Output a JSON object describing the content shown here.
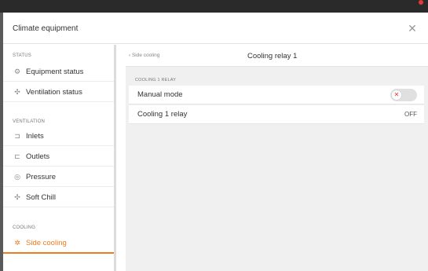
{
  "app": {
    "window_title": ""
  },
  "dialog": {
    "title": "Climate equipment",
    "close_icon": "close-icon"
  },
  "sidebar": {
    "sections": [
      {
        "label": "STATUS"
      },
      {
        "label": "VENTILATION"
      },
      {
        "label": "COOLING"
      }
    ],
    "items": [
      {
        "label": "Equipment status",
        "icon": "equipment-icon",
        "glyph": "⚙"
      },
      {
        "label": "Ventilation status",
        "icon": "fan-icon",
        "glyph": "✣"
      },
      {
        "label": "Inlets",
        "icon": "inlet-icon",
        "glyph": "⊐"
      },
      {
        "label": "Outlets",
        "icon": "outlet-icon",
        "glyph": "⊏"
      },
      {
        "label": "Pressure",
        "icon": "pressure-icon",
        "glyph": "◎"
      },
      {
        "label": "Soft Chill",
        "icon": "fan-icon",
        "glyph": "✣"
      },
      {
        "label": "Side cooling",
        "icon": "cooling-icon",
        "glyph": "✲",
        "active": true
      }
    ]
  },
  "main": {
    "back_label": "‹  Side cooling",
    "title": "Cooling relay 1",
    "group_label": "COOLING 1 RELAY",
    "rows": [
      {
        "label": "Manual mode",
        "control": "toggle",
        "toggle_on": false,
        "knob_glyph": "✕"
      },
      {
        "label": "Cooling 1 relay",
        "value": "OFF"
      }
    ]
  },
  "colors": {
    "accent": "#f07c1e",
    "toggle_off": "#e0e0e0",
    "toggle_x": "#e53935"
  }
}
